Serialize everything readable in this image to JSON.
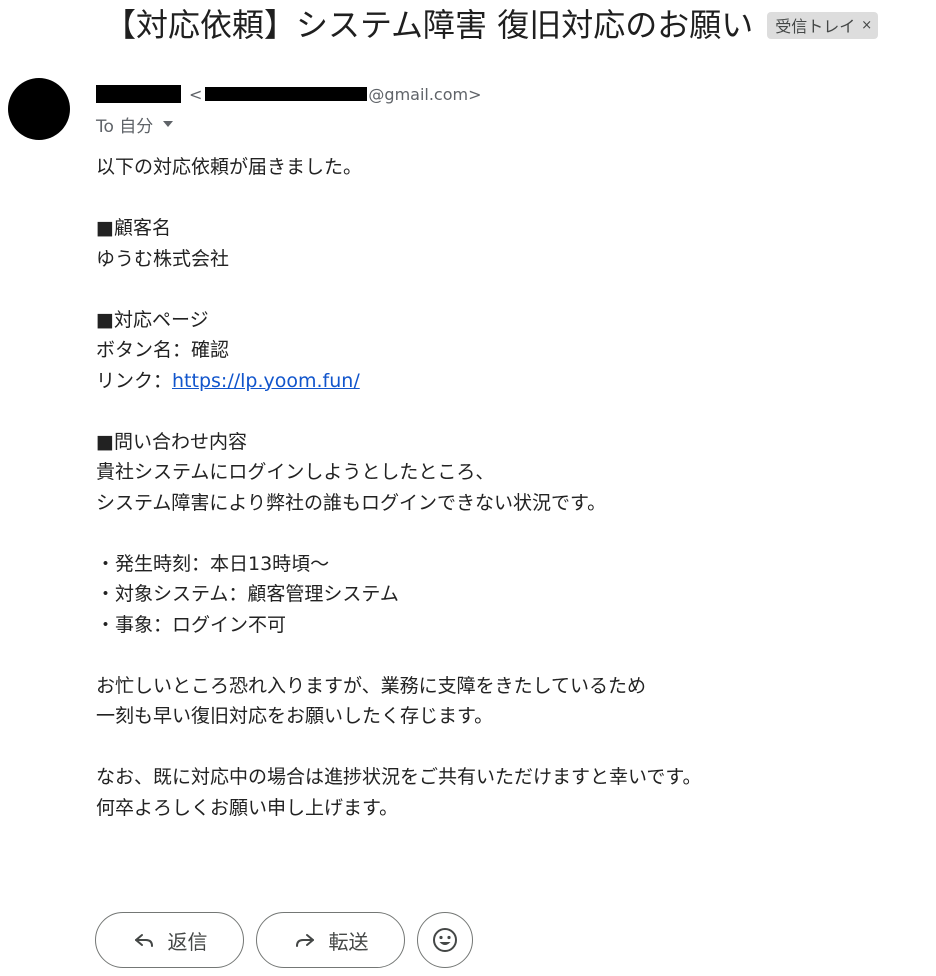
{
  "message": {
    "subject": "【対応依頼】システム障害 復旧対応のお願い",
    "label": "受信トレイ",
    "label_remove": "×",
    "sender": {
      "lt": "<",
      "email_domain": "@gmail.com>"
    },
    "to": "To 自分",
    "body": [
      "以下の対応依頼が届きました。",
      "",
      "■顧客名",
      "ゆうむ株式会社",
      "",
      "■対応ページ",
      "ボタン名：確認",
      "",
      "",
      "■問い合わせ内容",
      "貴社システムにログインしようとしたところ、",
      "システム障害により弊社の誰もログインできない状況です。",
      "",
      "・発生時刻：本日13時頃〜",
      "・対象システム：顧客管理システム",
      "・事象：ログイン不可",
      "",
      "お忙しいところ恐れ入りますが、業務に支障をきたしているため",
      "一刻も早い復旧対応をお願いしたく存じます。",
      "",
      "なお、既に対応中の場合は進捗状況をご共有いただけますと幸いです。",
      "何卒よろしくお願い申し上げます。"
    ],
    "link_line": {
      "prefix": "リンク：",
      "url": "https://lp.yoom.fun/"
    }
  },
  "actions": {
    "reply": "返信",
    "forward": "転送"
  },
  "icons": {
    "reply": "reply-arrow-icon",
    "forward": "forward-arrow-icon",
    "emoji": "emoji-smile-icon",
    "dropdown": "caret-down-icon"
  }
}
